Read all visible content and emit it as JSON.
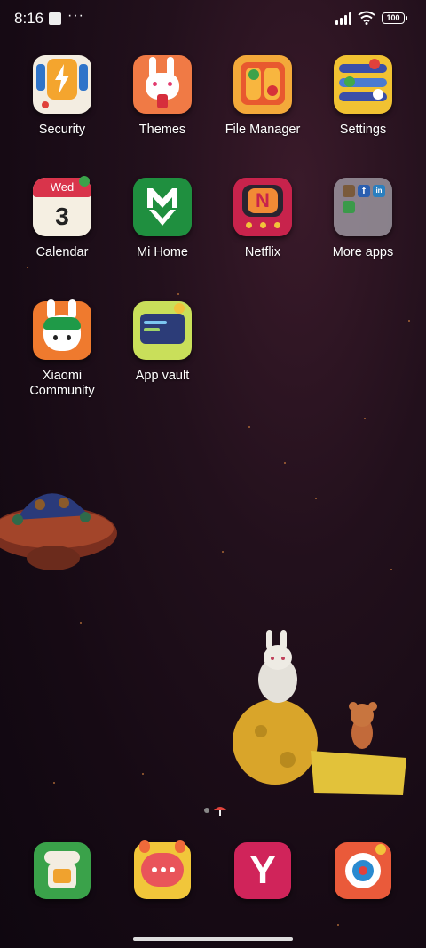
{
  "status_bar": {
    "time": "8:16",
    "more": "···",
    "battery": "100"
  },
  "apps": [
    {
      "label": "Security"
    },
    {
      "label": "Themes"
    },
    {
      "label": "File Manager"
    },
    {
      "label": "Settings"
    },
    {
      "label": "Calendar",
      "weekday": "Wed",
      "day": "3"
    },
    {
      "label": "Mi Home"
    },
    {
      "label": "Netflix",
      "glyph": "N"
    },
    {
      "label": "More apps"
    },
    {
      "label": "Xiaomi\nCommunity"
    },
    {
      "label": "App vault"
    }
  ],
  "dock": [
    {
      "name": "phone"
    },
    {
      "name": "messaging"
    },
    {
      "name": "browser",
      "glyph": "Y"
    },
    {
      "name": "camera"
    }
  ],
  "colors": {
    "bg": "#1b0c17",
    "accent": "#f2a93a"
  }
}
